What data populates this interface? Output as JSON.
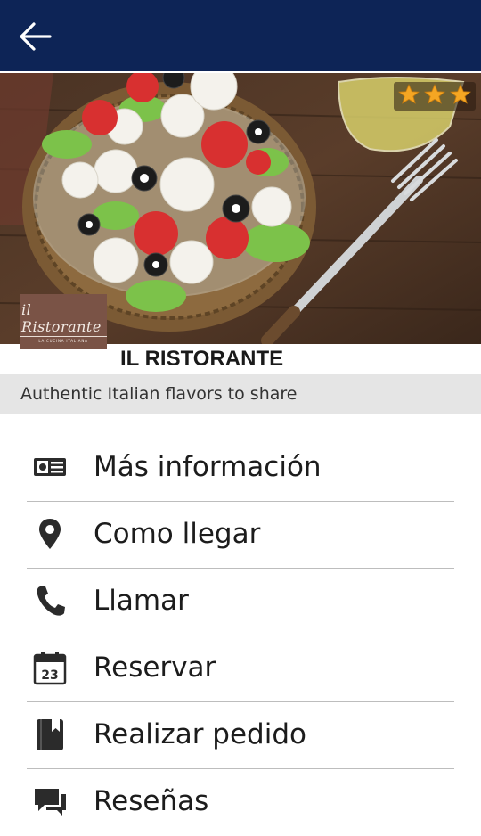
{
  "header": {
    "back_icon": "arrow-left-icon"
  },
  "hero": {
    "rating_stars": 3,
    "image": "caprese salad with mozzarella, tomatoes, olives and fork"
  },
  "restaurant": {
    "logo_text": "il Ristorante",
    "logo_subtext": "LA CUCINA ITALIANA",
    "name": "IL RISTORANTE",
    "tagline": "Authentic Italian flavors to share"
  },
  "menu": {
    "items": [
      {
        "label": "Más información",
        "icon": "info-card-icon"
      },
      {
        "label": "Como llegar",
        "icon": "location-pin-icon"
      },
      {
        "label": "Llamar",
        "icon": "phone-icon"
      },
      {
        "label": "Reservar",
        "icon": "calendar-icon",
        "icon_text": "23"
      },
      {
        "label": "Realizar pedido",
        "icon": "order-book-icon"
      },
      {
        "label": "Reseñas",
        "icon": "reviews-chat-icon"
      }
    ]
  },
  "colors": {
    "appbar": "#0d2456",
    "subtitle_bar": "#e5e5e5",
    "logo_bg": "#7a5346",
    "star": "#f5a623"
  }
}
